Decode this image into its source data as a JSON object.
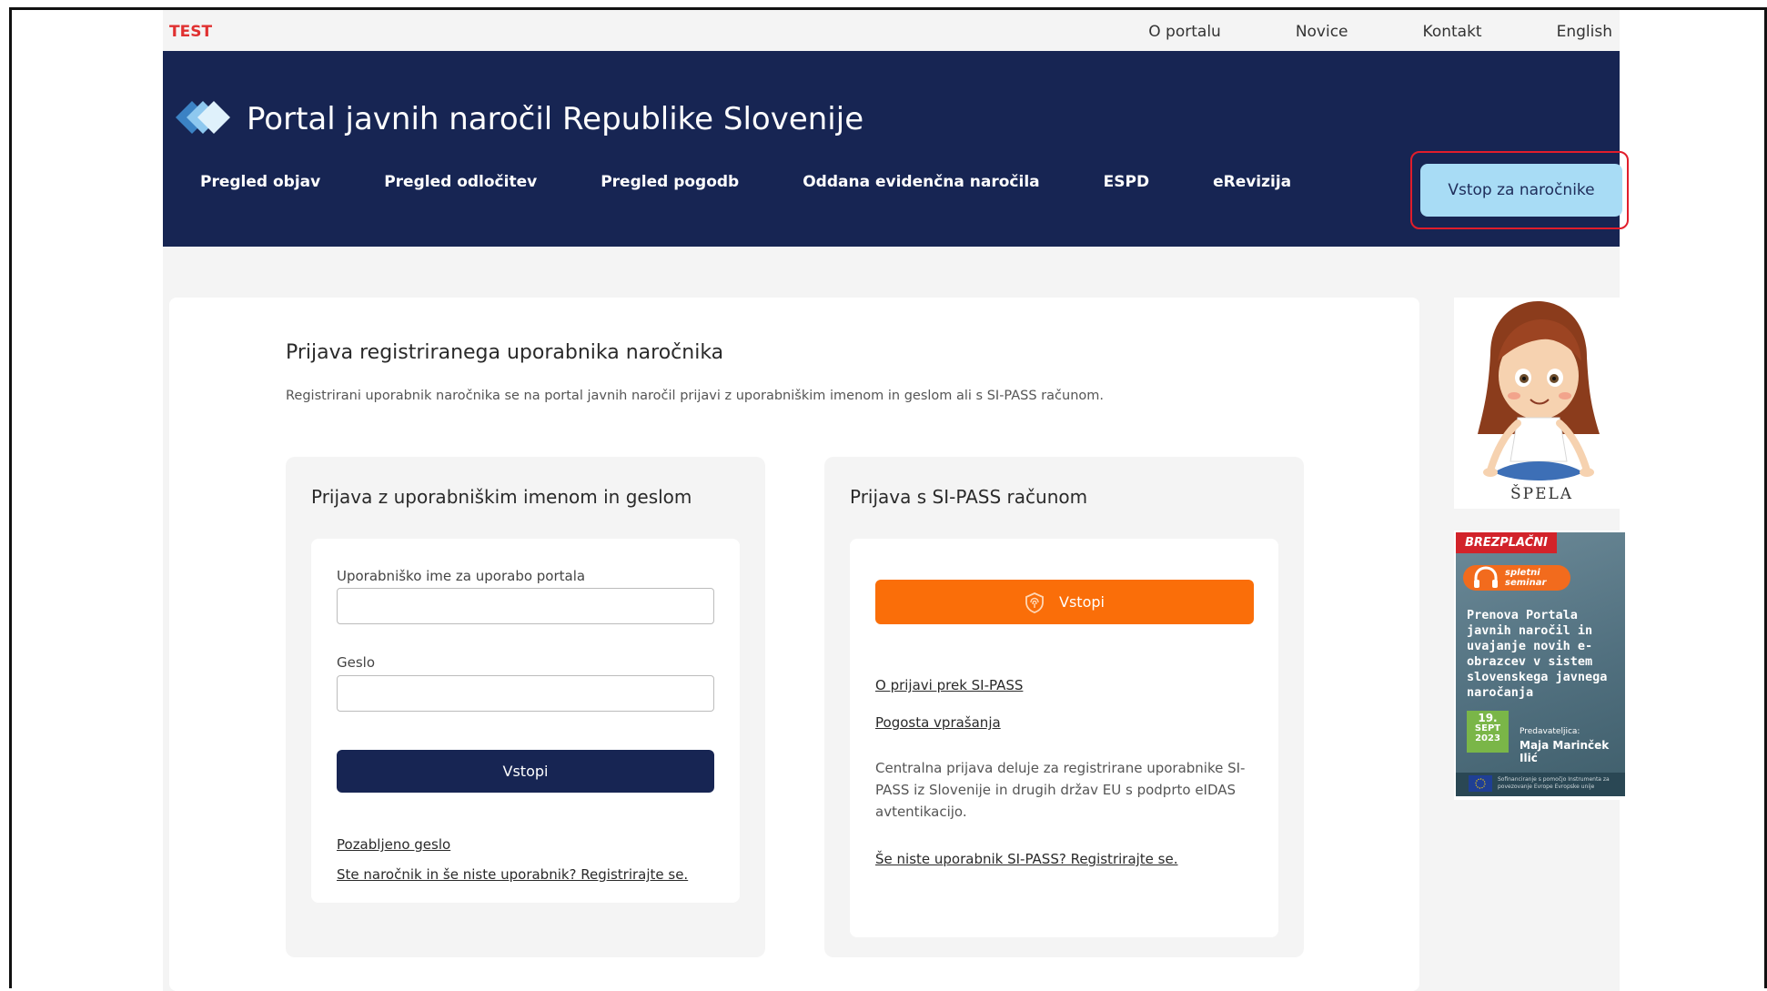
{
  "topbar": {
    "env_label": "TEST",
    "links": [
      "O portalu",
      "Novice",
      "Kontakt",
      "English"
    ]
  },
  "header": {
    "title": "Portal javnih naročil Republike Slovenije",
    "nav": [
      "Pregled objav",
      "Pregled odločitev",
      "Pregled pogodb",
      "Oddana evidenčna naročila",
      "ESPD",
      "eRevizija"
    ],
    "login_button": "Vstop za naročnike"
  },
  "main": {
    "title": "Prijava registriranega uporabnika naročnika",
    "intro": "Registrirani uporabnik naročnika se na portal javnih naročil prijavi z uporabniškim imenom in geslom ali s SI-PASS računom.",
    "password_login": {
      "title": "Prijava z uporabniškim imenom in geslom",
      "username_label": "Uporabniško ime za uporabo portala",
      "username_value": "",
      "password_label": "Geslo",
      "password_value": "",
      "submit_label": "Vstopi",
      "forgot_link": "Pozabljeno geslo",
      "register_link": "Ste naročnik in še niste uporabnik? Registrirajte se."
    },
    "sipass_login": {
      "title": "Prijava s SI-PASS računom",
      "submit_label": "Vstopi",
      "about_link": "O prijavi prek SI-PASS",
      "faq_link": "Pogosta vprašanja",
      "description": "Centralna prijava deluje za registrirane uporabnike SI-PASS iz Slovenije in drugih držav EU s podprto eIDAS avtentikacijo.",
      "register_link": "Še niste uporabnik SI-PASS? Registrirajte se."
    }
  },
  "sidebar": {
    "mascot_caption": "ŠPELA",
    "ad": {
      "badge": "BREZPLAČNI",
      "pill": "spletni seminar",
      "title": "Prenova Portala javnih naročil in uvajanje novih e-obrazcev v sistem slovenskega javnega naročanja",
      "date_day": "19.",
      "date_month": "SEPT",
      "date_year": "2023",
      "speaker_label": "Predavateljica:",
      "speaker": "Maja Marinček Ilić",
      "footer": "Sofinanciranje s pomočjo Instrumenta za povezovanje Evrope Evropske unije"
    }
  },
  "colors": {
    "header_bg": "#172553",
    "login_btn_bg": "#a8dcf5",
    "highlight_border": "#e11d2b",
    "orange": "#fa6e09",
    "test_red": "#e03131"
  }
}
